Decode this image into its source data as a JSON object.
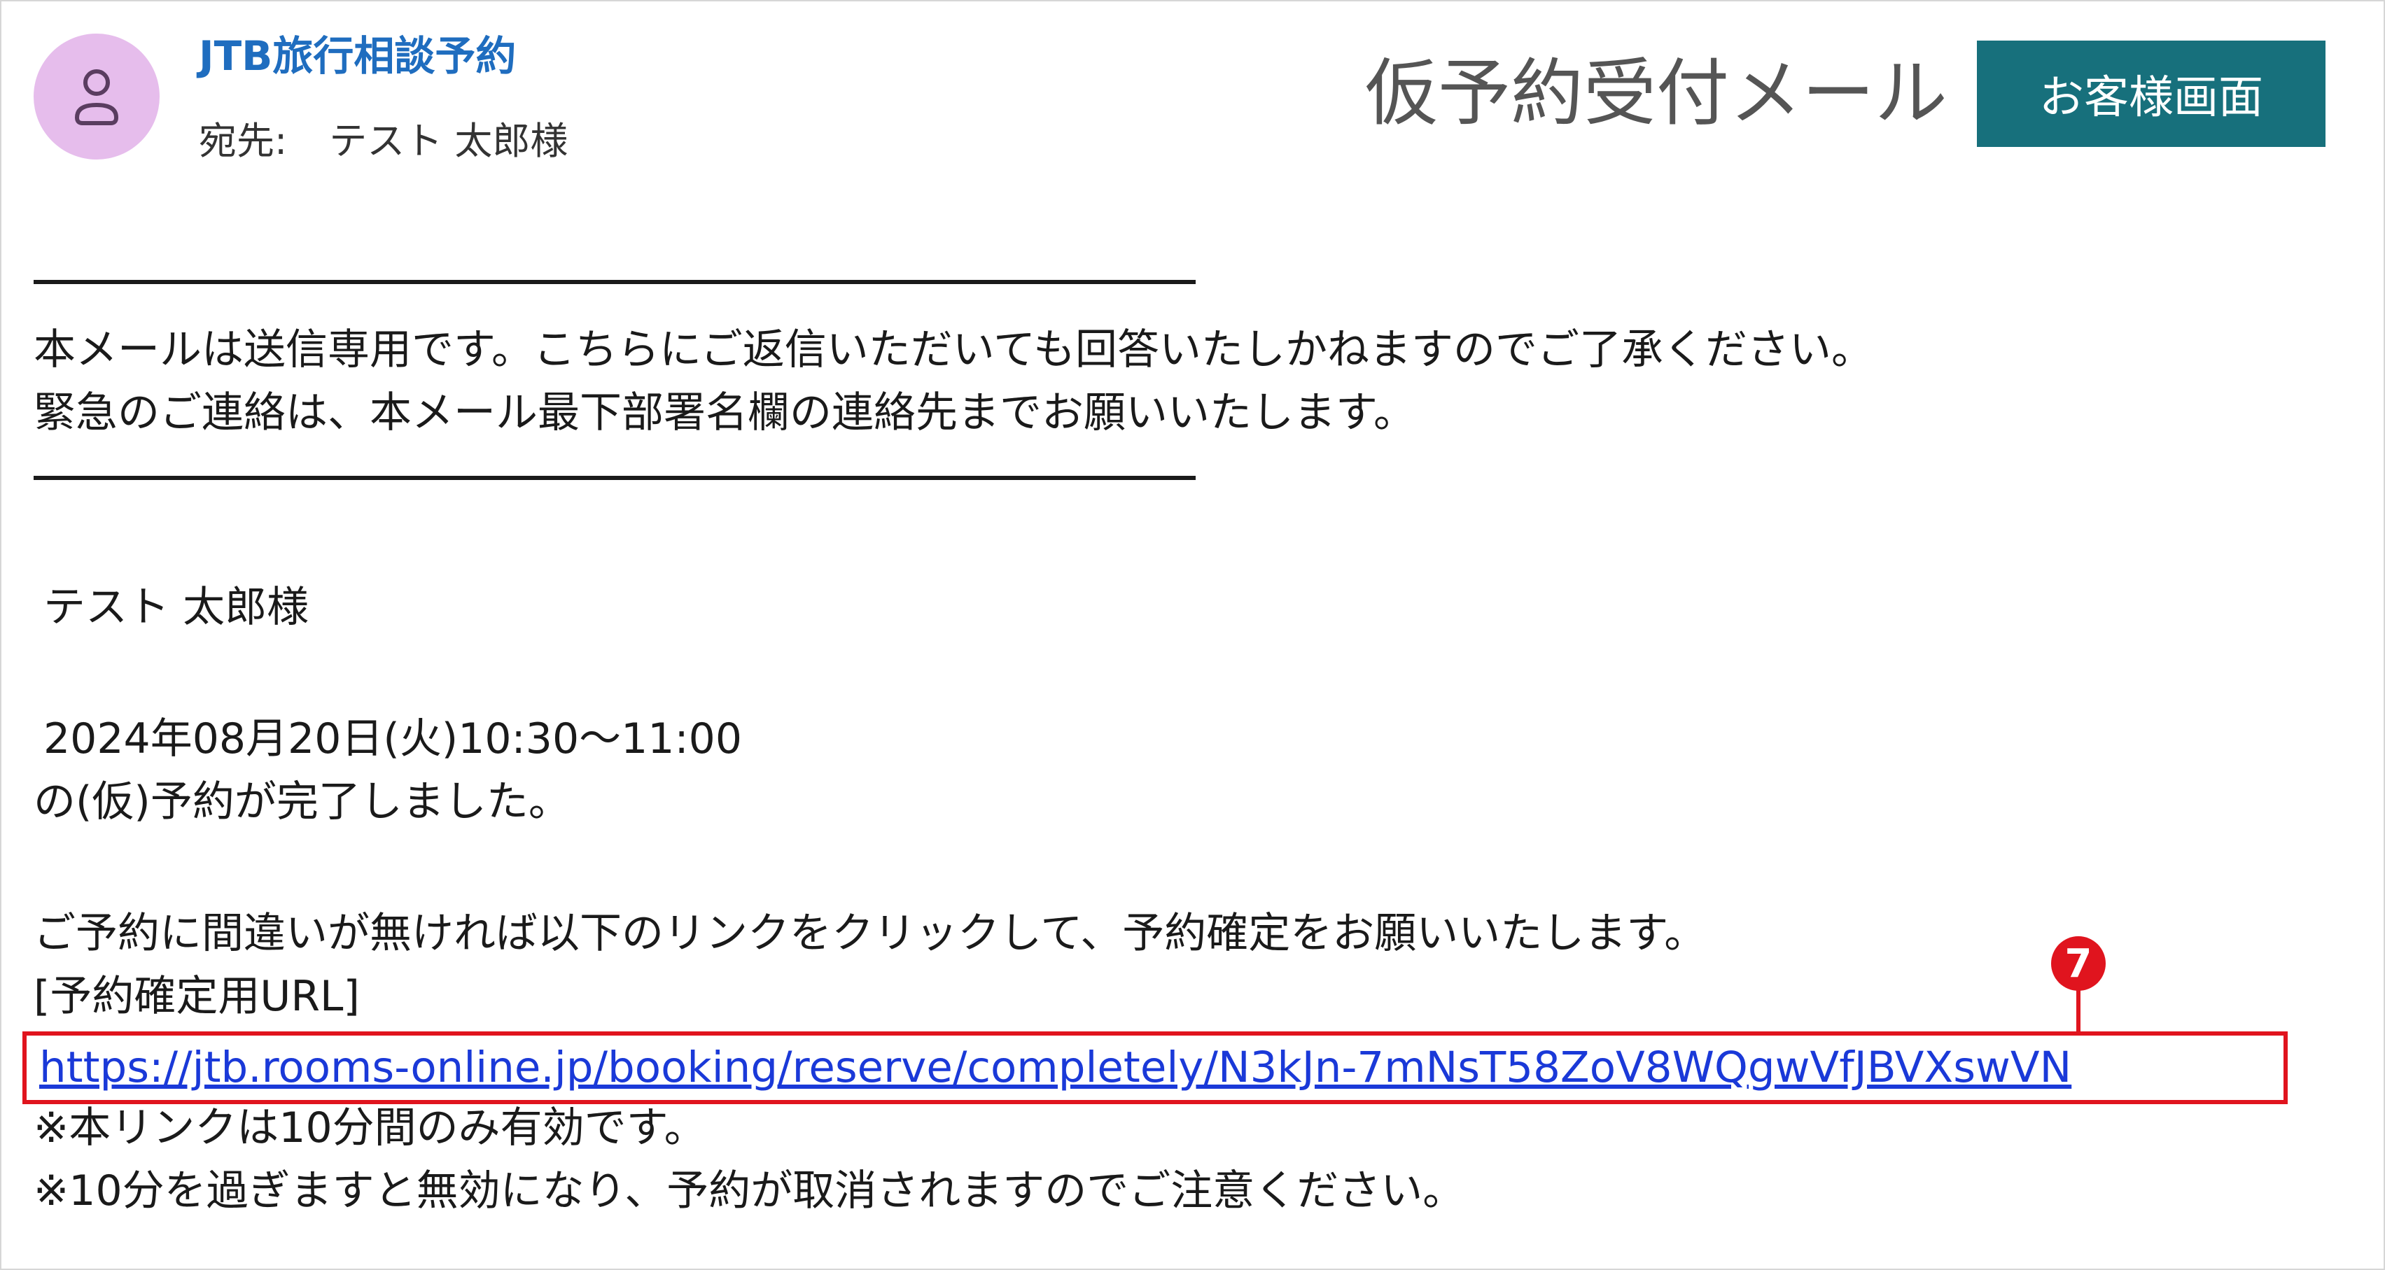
{
  "header": {
    "sender_name": "JTB旅行相談予約",
    "to_label": "宛先:",
    "to_value": "テスト 太郎様",
    "mail_type": "仮予約受付メール",
    "customer_button_label": "お客様画面",
    "avatar_icon": "person-icon"
  },
  "notice": {
    "line1": "本メールは送信専用です。こちらにご返信いただいても回答いたしかねますのでご了承ください。",
    "line2": "緊急のご連絡は、本メール最下部署名欄の連絡先までお願いいたします。"
  },
  "body": {
    "recipient": "テスト 太郎様",
    "datetime": "2024年08月20日(火)10:30〜11:00",
    "completed": "の(仮)予約が完了しました。",
    "instruction": "ご予約に間違いが無ければ以下のリンクをクリックして、予約確定をお願いいたします。",
    "url_label": "[予約確定用URL]",
    "url": "https://jtb.rooms-online.jp/booking/reserve/completely/N3kJn-7mNsT58ZoV8WQgwVfJBVXswVN",
    "validity_note": "※本リンクは10分間のみ有効です。",
    "expiry_note": "※10分を過ぎますと無効になり、予約が取消されますのでご注意ください。"
  },
  "annotation": {
    "marker_label": "7"
  },
  "colors": {
    "sender_blue": "#1f6dbf",
    "button_teal": "#17707c",
    "avatar_bg": "#e6bdec",
    "highlight_red": "#e0141e",
    "link_blue": "#1a39d8"
  }
}
